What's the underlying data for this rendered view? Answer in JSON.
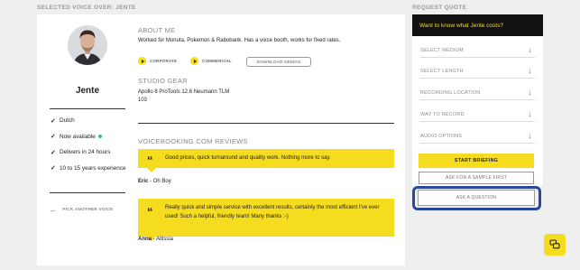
{
  "sections": {
    "voice_label": "SELECTED VOICE OVER: JENTE",
    "quote_label": "REQUEST QUOTE"
  },
  "profile": {
    "name": "Jente",
    "facts": [
      {
        "text": "Dutch"
      },
      {
        "text": "Now available"
      },
      {
        "text": "Delivers in 24 hours"
      },
      {
        "text": "10 to 15 years experience"
      }
    ],
    "pick_another": "PICK ANOTHER VOICE"
  },
  "about": {
    "heading": "ABOUT ME",
    "text": "Worked for Monuta, Pokemon & Rabobank. Has a voice booth, works for fixed rates.",
    "demos": [
      {
        "label": "CORPORATE"
      },
      {
        "label": "COMMERCIAL"
      }
    ],
    "download_label": "DOWNLOAD DEMOS"
  },
  "gear": {
    "heading": "STUDIO GEAR",
    "line1": "Apollo 8 ProTools 12.6 Neumann TLM",
    "line2": "103"
  },
  "reviews": {
    "heading": "VOICEBOOKING.COM REVIEWS",
    "quote_mark": "“",
    "items": [
      {
        "text": "Good prices, quick turnaround and quality work. Nothing more to say.",
        "author": "Eric",
        "company": "Oh Boy"
      },
      {
        "text": "Really quick and simple service with excellent results, certainly the most efficient I've ever used! Such a helpful, friendly team! Many thanks :-)",
        "author": "Anna",
        "company": "Altissia"
      }
    ]
  },
  "quote": {
    "header": "Want to know what Jente costs?",
    "selects": [
      {
        "label": "SELECT MEDIUM"
      },
      {
        "label": "SELECT LENGTH"
      },
      {
        "label": "RECORDING LOCATION"
      },
      {
        "label": "WAY TO RECORD"
      },
      {
        "label": "AUDIO OPTIONS"
      }
    ],
    "start_label": "START BRIEFING",
    "sample_label": "ASK FOR A SAMPLE FIRST",
    "ask_label": "ASK A QUESTION"
  },
  "colors": {
    "accent_yellow": "#f5dc1e",
    "highlight_blue": "#2a48a0",
    "available_green": "#3ac25d",
    "header_black": "#111111"
  },
  "icons": {
    "check": "check-icon",
    "arrow_left": "arrow-left-icon",
    "play": "play-icon",
    "chevron": "arrow-down-icon",
    "chat": "chat-icon"
  }
}
